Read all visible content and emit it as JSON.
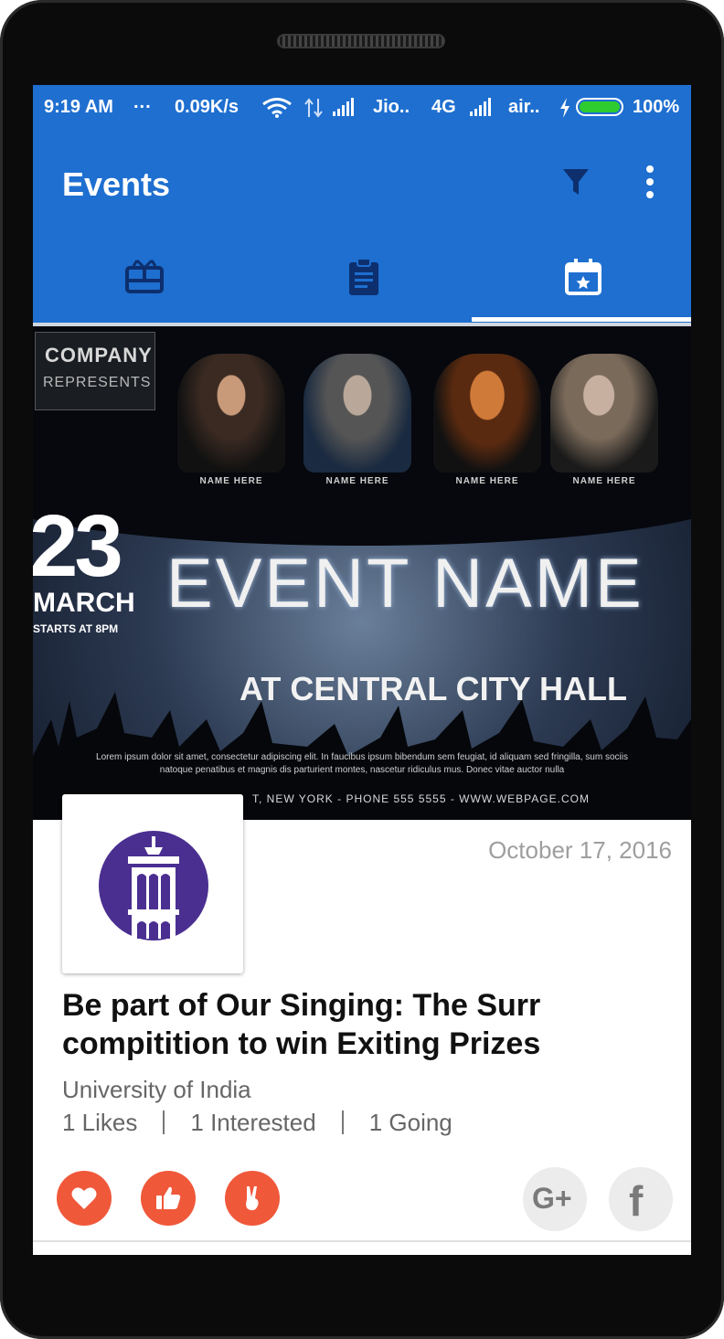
{
  "status_bar": {
    "time": "9:19 AM",
    "dots": "...",
    "speed": "0.09K/s",
    "carrier1": "Jio..",
    "network": "4G",
    "carrier2": "air..",
    "battery_level": 1.0,
    "battery_text": "100%",
    "battery_color": "#2ecc2e",
    "icons": [
      "wifi-icon",
      "data-arrows-icon",
      "signal-icon",
      "signal-icon",
      "charging-icon",
      "battery-icon"
    ]
  },
  "app_bar": {
    "title": "Events",
    "background_color": "#1e6fd0",
    "actions": [
      "filter-icon",
      "more-vert-icon"
    ]
  },
  "tabs": [
    {
      "icon": "gift-card-icon",
      "selected": false
    },
    {
      "icon": "clipboard-icon",
      "selected": false
    },
    {
      "icon": "calendar-star-icon",
      "selected": true
    }
  ],
  "banner": {
    "company": "COMPANY",
    "represents": "REPRESENTS",
    "singer_names": [
      "NAME HERE",
      "NAME HERE",
      "NAME HERE",
      "NAME HERE"
    ],
    "day": "23",
    "month": "MARCH",
    "starts": "STARTS AT 8PM",
    "event_name": "EVENT NAME",
    "venue": "AT CENTRAL CITY HALL",
    "lorem_line1": "Lorem ipsum dolor sit amet, consectetur adipiscing elit. In faucibus ipsum bibendum sem feugiat, id aliquam sed fringilla, sum sociis",
    "lorem_line2": "natoque penatibus et magnis dis parturient montes, nascetur ridiculus mus. Donec vitae auctor nulla",
    "footer": "T, NEW YORK  -  PHONE 555 5555  -  WWW.WEBPAGE.COM"
  },
  "event": {
    "date": "October 17, 2016",
    "title": "Be part of Our Singing: The Surr compitition to win Exiting Prizes",
    "organizer": "University of India",
    "stats": {
      "likes": "1 Likes",
      "interested": "1 Interested",
      "going": "1 Going"
    },
    "logo_icon": "university-building-icon",
    "logo_color": "#4a2f91"
  },
  "actions": {
    "accent_color": "#f0583a",
    "buttons": [
      "heart-icon",
      "thumbs-up-icon",
      "victory-hand-icon"
    ],
    "social": {
      "gplus": "G+",
      "facebook": "f"
    }
  }
}
